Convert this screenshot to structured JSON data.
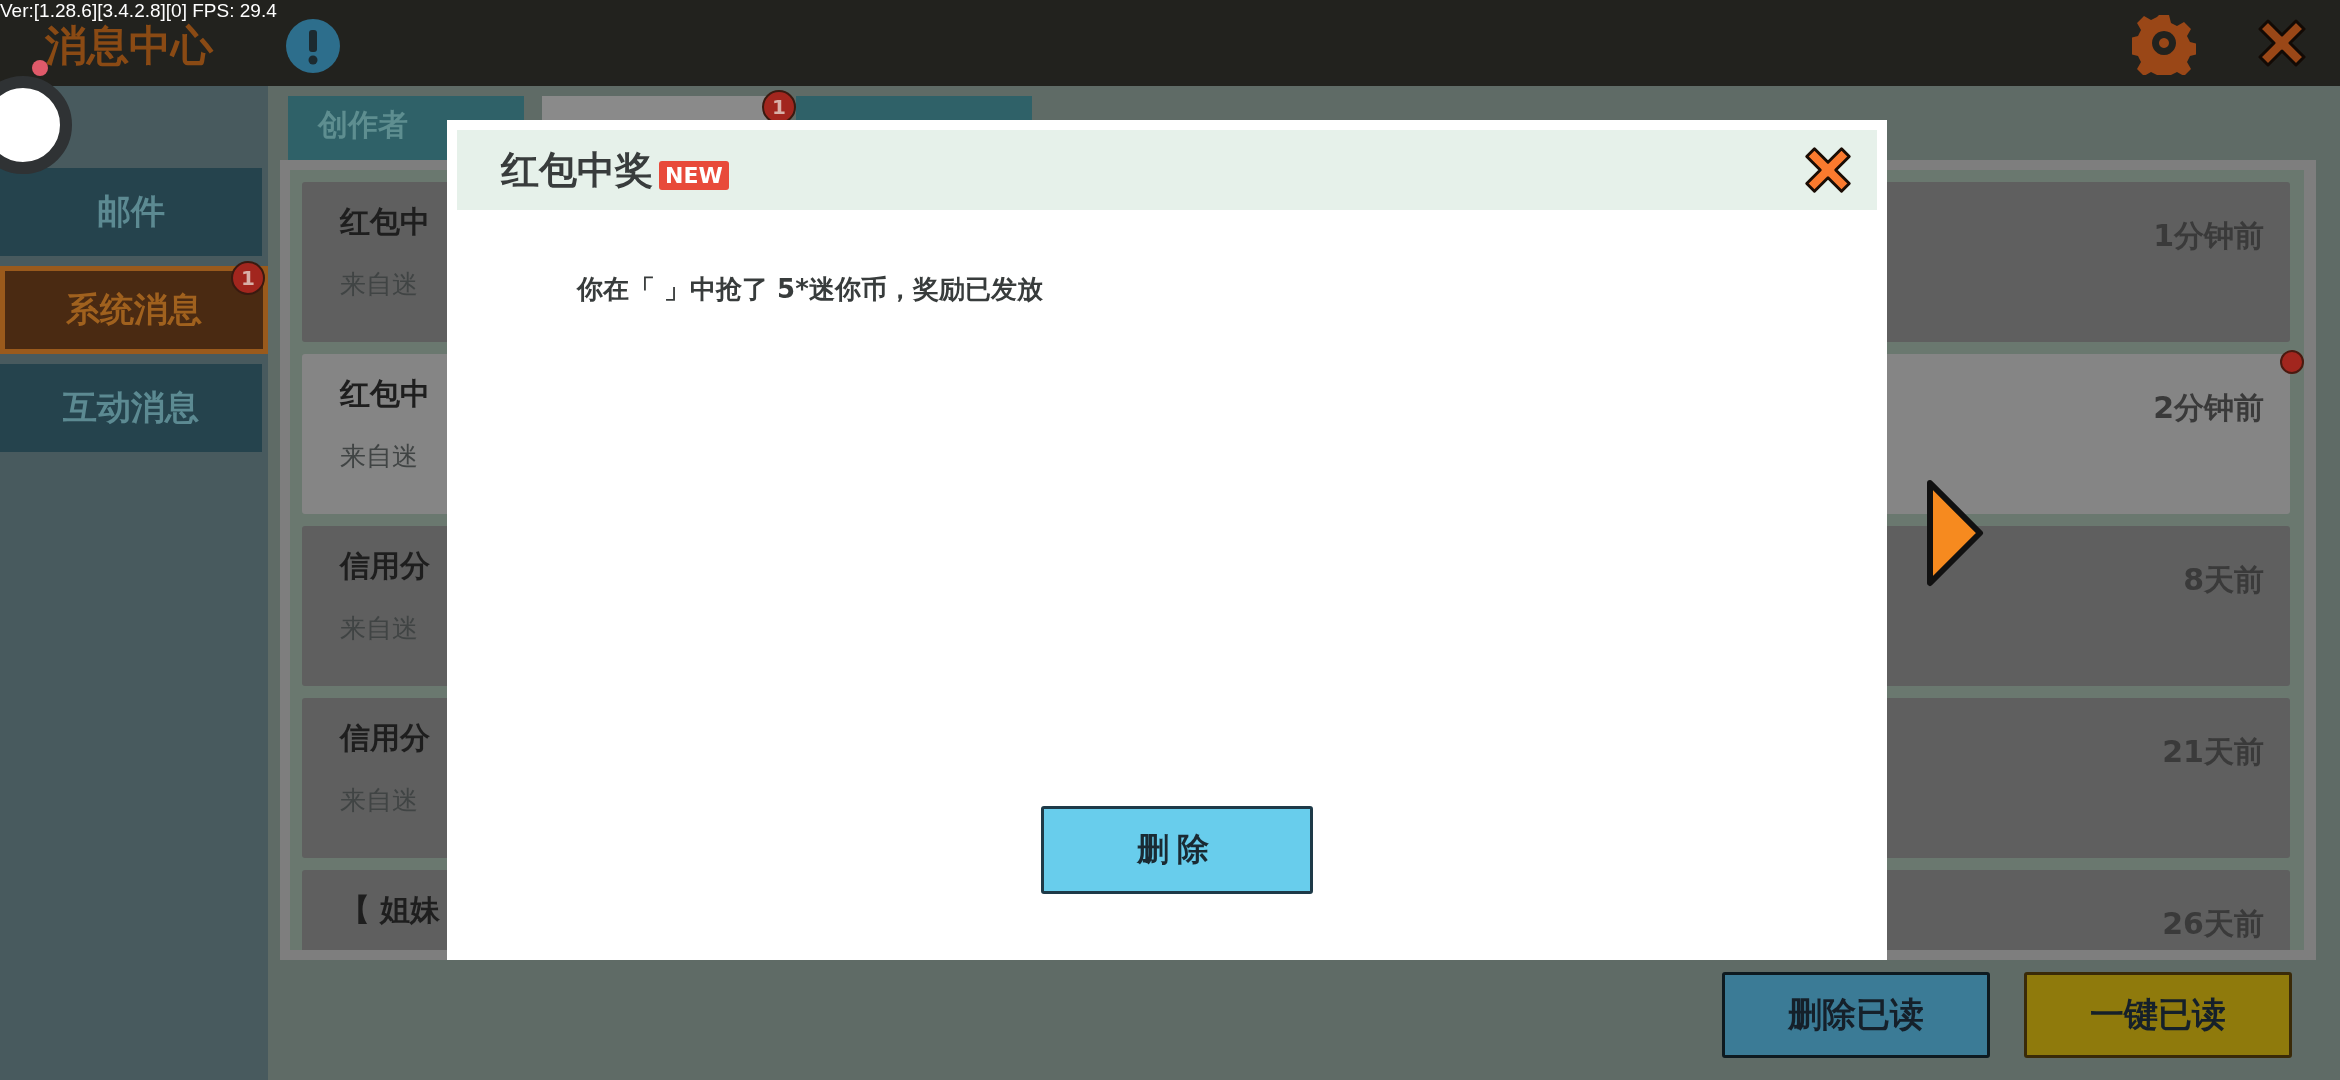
{
  "debug_overlay": "Ver:[1.28.6][3.4.2.8][0] FPS: 29.4",
  "header": {
    "title": "消息中心"
  },
  "sidebar": {
    "items": [
      {
        "label": "邮件",
        "selected": false
      },
      {
        "label": "系统消息",
        "selected": true,
        "badge": "1"
      },
      {
        "label": "互动消息",
        "selected": false
      }
    ]
  },
  "tabs": [
    {
      "label": "创作者",
      "selected": false
    },
    {
      "selected": true,
      "badge": "1"
    },
    {
      "selected": false
    }
  ],
  "messages": [
    {
      "title": "红包中",
      "source": "来自迷",
      "time": "1分钟前",
      "selected": false,
      "unread": false
    },
    {
      "title": "红包中",
      "source": "来自迷",
      "time": "2分钟前",
      "selected": true,
      "unread": true
    },
    {
      "title": "信用分",
      "source": "来自迷",
      "time": "8天前",
      "selected": false,
      "unread": false
    },
    {
      "title": "信用分",
      "source": "来自迷",
      "time": "21天前",
      "selected": false,
      "unread": false
    },
    {
      "title": "【 姐妹",
      "time": "26天前",
      "selected": false,
      "unread": false
    }
  ],
  "footer_buttons": [
    {
      "label": "删除已读",
      "kind": "secondary"
    },
    {
      "label": "一键已读",
      "kind": "primary"
    }
  ],
  "dialog": {
    "title": "红包中奖",
    "badge": "NEW",
    "body": "你在「 」中抢了 5*迷你币，奖励已发放",
    "button": "删除"
  }
}
